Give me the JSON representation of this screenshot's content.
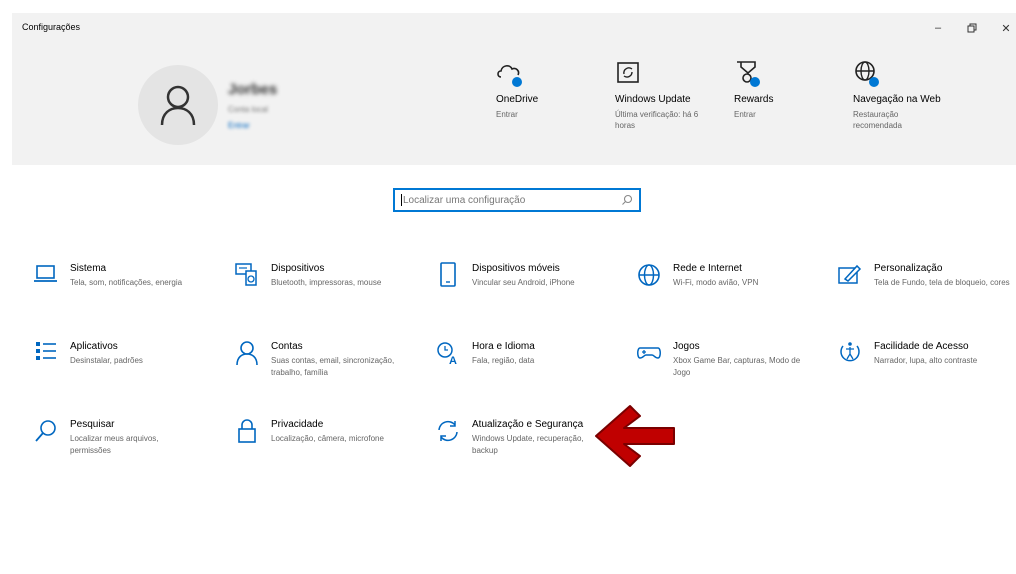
{
  "window": {
    "title": "Configurações",
    "minimize_icon": "minimize-icon",
    "maximize_icon": "restore-icon",
    "close_icon": "close-icon"
  },
  "account": {
    "name": "Jorbes",
    "subtitle": "Conta local",
    "link": "Entrar"
  },
  "header_items": [
    {
      "label": "OneDrive",
      "sub": "Entrar",
      "icon": "cloud-icon"
    },
    {
      "label": "Windows Update",
      "sub": "Última verificação: há 6 horas",
      "icon": "windows-update-icon"
    },
    {
      "label": "Rewards",
      "sub": "Entrar",
      "icon": "rewards-icon"
    },
    {
      "label": "Navegação na Web",
      "sub": "Restauração recomendada",
      "icon": "globe-icon"
    }
  ],
  "search": {
    "placeholder": "Localizar uma configuração",
    "icon": "search-icon"
  },
  "tiles": [
    {
      "label": "Sistema",
      "sub": "Tela, som, notificações, energia",
      "icon": "laptop-icon"
    },
    {
      "label": "Dispositivos",
      "sub": "Bluetooth, impressoras, mouse",
      "icon": "keyboard-speaker-icon"
    },
    {
      "label": "Dispositivos móveis",
      "sub": "Vincular seu Android, iPhone",
      "icon": "phone-icon"
    },
    {
      "label": "Rede e Internet",
      "sub": "Wi-Fi, modo avião, VPN",
      "icon": "globe-icon"
    },
    {
      "label": "Personalização",
      "sub": "Tela de Fundo, tela de bloqueio, cores",
      "icon": "paint-icon"
    },
    {
      "label": "Aplicativos",
      "sub": "Desinstalar, padrões",
      "icon": "apps-list-icon"
    },
    {
      "label": "Contas",
      "sub": "Suas contas, email, sincronização, trabalho, família",
      "icon": "person-icon"
    },
    {
      "label": "Hora e Idioma",
      "sub": "Fala, região, data",
      "icon": "time-language-icon"
    },
    {
      "label": "Jogos",
      "sub": "Xbox Game Bar, capturas, Modo de Jogo",
      "icon": "gamepad-icon"
    },
    {
      "label": "Facilidade de Acesso",
      "sub": "Narrador, lupa, alto contraste",
      "icon": "ease-of-access-icon"
    },
    {
      "label": "Pesquisar",
      "sub": "Localizar meus arquivos, permissões",
      "icon": "search-icon"
    },
    {
      "label": "Privacidade",
      "sub": "Localização, câmera, microfone",
      "icon": "lock-icon"
    },
    {
      "label": "Atualização e Segurança",
      "sub": "Windows Update, recuperação, backup",
      "icon": "sync-icon"
    }
  ],
  "colors": {
    "accent": "#0078d4",
    "header_bg": "#f2f2f2",
    "arrow": "#c00000"
  }
}
